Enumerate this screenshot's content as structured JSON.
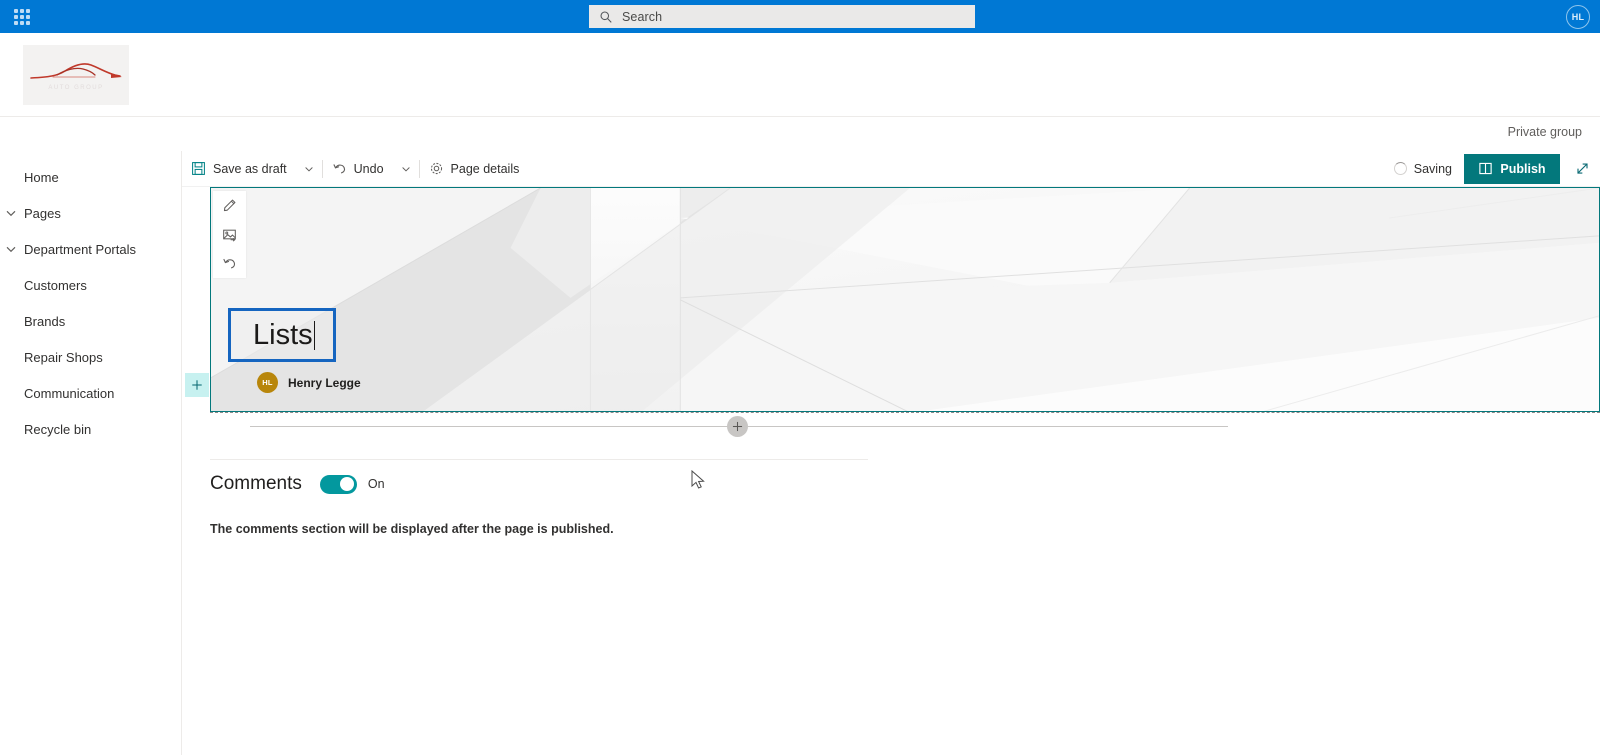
{
  "suite": {
    "waffle_icon": "app-launcher-waffle-icon",
    "search": {
      "placeholder": "Search",
      "value": "",
      "icon": "search-icon"
    },
    "avatar_initials": "HL",
    "brand_color": "#0078d4"
  },
  "site": {
    "logo_alt": "car-silhouette-logo",
    "privacy_label": "Private group"
  },
  "nav": {
    "items": [
      {
        "label": "Home",
        "expandable": false
      },
      {
        "label": "Pages",
        "expandable": true
      },
      {
        "label": "Department Portals",
        "expandable": true
      },
      {
        "label": "Customers",
        "expandable": false
      },
      {
        "label": "Brands",
        "expandable": false
      },
      {
        "label": "Repair Shops",
        "expandable": false
      },
      {
        "label": "Communication",
        "expandable": false
      },
      {
        "label": "Recycle bin",
        "expandable": false
      }
    ]
  },
  "command_bar": {
    "save_as_draft": "Save as draft",
    "save_icon": "save-icon",
    "undo": "Undo",
    "undo_icon": "undo-icon",
    "page_details": "Page details",
    "page_details_icon": "gear-icon",
    "caret_icon": "chevron-down-icon",
    "saving_status": "Saving",
    "publish_label": "Publish",
    "publish_icon": "publish-book-icon",
    "publish_color": "#03787c",
    "expand_icon": "expand-diagonal-icon"
  },
  "hero": {
    "tools": [
      {
        "icon": "pencil-edit-icon",
        "name": "edit-web-part"
      },
      {
        "icon": "change-image-icon",
        "name": "change-image"
      },
      {
        "icon": "undo-reset-icon",
        "name": "reset-image"
      }
    ],
    "title_value": "Lists",
    "author_initials": "HL",
    "author_name": "Henry Legge",
    "author_avatar_color": "#b8860b",
    "selection_color": "#03787c",
    "title_focus_color": "#1565c0"
  },
  "canvas": {
    "add_section_icon": "plus-icon",
    "add_column_icon": "plus-icon"
  },
  "comments": {
    "title": "Comments",
    "toggle_state": "On",
    "toggle_on": true,
    "toggle_color": "#03989e",
    "hint": "The comments section will be displayed after the page is published."
  }
}
